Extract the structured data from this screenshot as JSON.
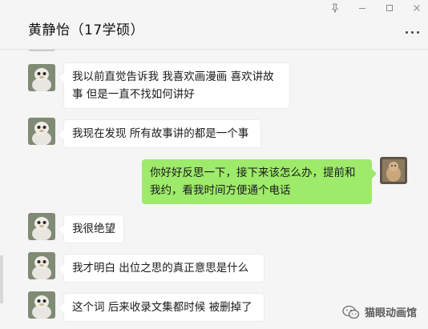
{
  "header": {
    "title": "黄静怡（17学硕）",
    "controls": {
      "pin": "pin-icon",
      "minimize": "minimize-icon",
      "maximize": "maximize-icon",
      "close": "close-icon"
    },
    "more": "more-icon"
  },
  "messages": [
    {
      "side": "left",
      "text_lines": [
        "我以前直觉告诉我 我喜欢画漫画  喜欢讲故",
        "事  但是一直不找如何讲好"
      ]
    },
    {
      "side": "left",
      "text_lines": [
        "我现在发现 所有故事讲的都是一个事"
      ]
    },
    {
      "side": "right",
      "text_lines": [
        "你好好反思一下，接下来该怎么办，提前和",
        "我约，看我时间方便通个电话"
      ]
    },
    {
      "side": "left",
      "text_lines": [
        "我很绝望"
      ]
    },
    {
      "side": "left",
      "text_lines": [
        "我才明白  出位之思的真正意思是什么"
      ]
    },
    {
      "side": "left",
      "text_lines": [
        "这个词 后来收录文集都时候 被删掉了"
      ]
    }
  ],
  "watermark": {
    "text": "猫眼动画馆",
    "icon": "wechat-icon"
  },
  "colors": {
    "bubble_right": "#9eea6a",
    "bubble_left": "#ffffff",
    "background": "#f5f5f5"
  }
}
